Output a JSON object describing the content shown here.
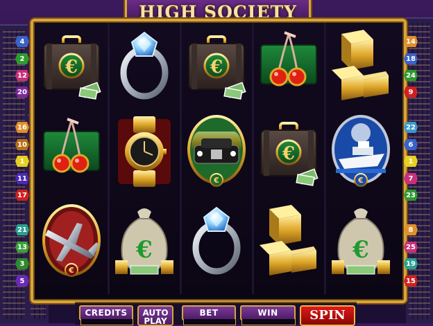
{
  "game": {
    "title": "HIGH SOCIETY"
  },
  "paylines": {
    "left": [
      "4",
      "2",
      "12",
      "20",
      "16",
      "10",
      "1",
      "11",
      "17",
      "21",
      "13",
      "3",
      "5"
    ],
    "right": [
      "14",
      "18",
      "24",
      "9",
      "22",
      "6",
      "1",
      "7",
      "23",
      "8",
      "25",
      "19",
      "15"
    ],
    "left_colors": [
      "#3a63c8",
      "#2e9a2e",
      "#c8307a",
      "#7a2a9a",
      "#e0902a",
      "#b8701a",
      "#e8d020",
      "#4a2ab0",
      "#d02020",
      "#2aa090",
      "#3aa03a",
      "#2e8a2e",
      "#6a2ab8"
    ],
    "right_colors": [
      "#e0902a",
      "#3a63c8",
      "#2e9a2e",
      "#d02020",
      "#3a9ad0",
      "#3a63c8",
      "#e8d020",
      "#c8307a",
      "#2e9a2e",
      "#e0902a",
      "#c8307a",
      "#2aa090",
      "#d02020"
    ]
  },
  "reels": [
    [
      "briefcase-euro-icon",
      "cherries-icon",
      "jet-plane-icon"
    ],
    [
      "diamond-ring-icon",
      "gold-watch-icon",
      "money-bag-icon"
    ],
    [
      "briefcase-euro-icon",
      "limousine-icon",
      "diamond-ring-icon"
    ],
    [
      "cherries-icon",
      "briefcase-euro-icon",
      "gold-bars-icon"
    ],
    [
      "gold-bars-icon",
      "yacht-icon",
      "money-bag-icon"
    ]
  ],
  "controls": {
    "credits_label": "CREDITS",
    "autoplay_label_1": "AUTO",
    "autoplay_label_2": "PLAY",
    "bet_label": "BET",
    "win_label": "WIN",
    "spin_label": "SPIN"
  },
  "colors": {
    "gold": "#d7a63a",
    "purple": "#6a2c86",
    "spin_red": "#e01818"
  }
}
